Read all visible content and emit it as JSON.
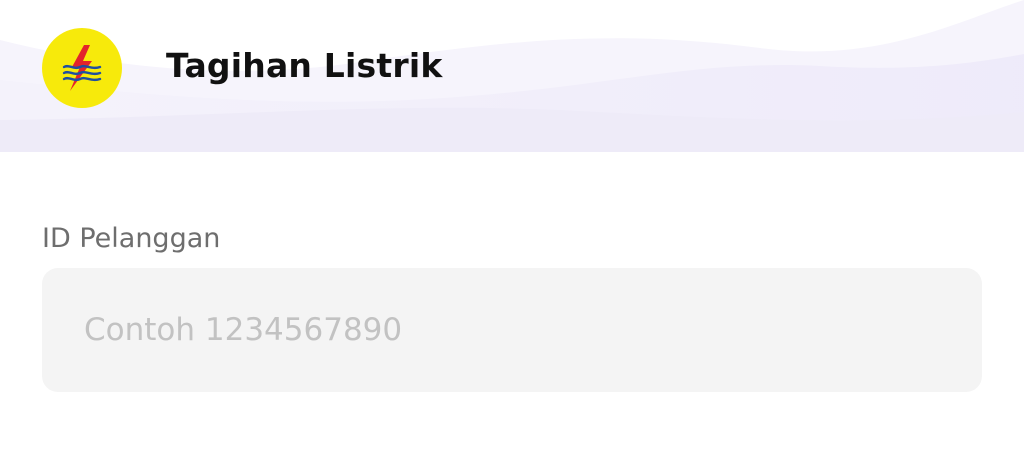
{
  "header": {
    "title": "Tagihan Listrik",
    "logo_icon": "electric-bolt-icon",
    "logo_color": "#f7ea0b",
    "logo_accent": "#e3242b"
  },
  "form": {
    "id_label": "ID Pelanggan",
    "id_value": "",
    "id_placeholder": "Contoh 1234567890"
  }
}
